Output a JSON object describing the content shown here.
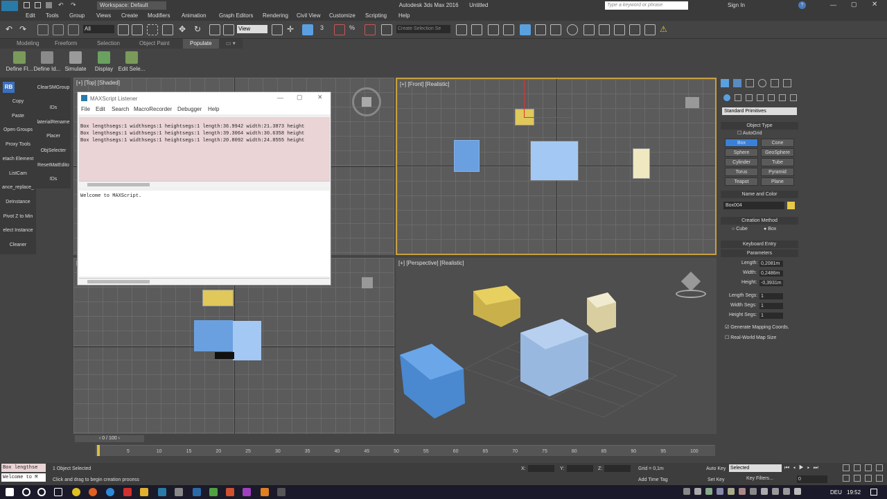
{
  "app": {
    "title": "Autodesk 3ds Max 2016",
    "document": "Untitled",
    "workspace": "Workspace: Default",
    "search_placeholder": "Type a keyword or phrase",
    "signin": "Sign In"
  },
  "menu": [
    "Edit",
    "Tools",
    "Group",
    "Views",
    "Create",
    "Modifiers",
    "Animation",
    "Graph Editors",
    "Rendering",
    "Civil View",
    "Customize",
    "Scripting",
    "Help"
  ],
  "toolbar": {
    "filter": "All",
    "view": "View",
    "selection_set": "Create Selection Se"
  },
  "ribbon_tabs": [
    "Modeling",
    "Freeform",
    "Selection",
    "Object Paint",
    "Populate"
  ],
  "ribbon_buttons": [
    "Define Fl...",
    "Define Id...",
    "Simulate",
    "Display",
    "Edit Sele..."
  ],
  "left_col1": [
    "Copy",
    "Paste",
    "Open Groups",
    "Proxy Tools",
    "etach Element",
    "ListCam",
    "ance_replace_",
    "DeInstance",
    "Pivot Z to Min",
    "elect Instance",
    "Cleaner"
  ],
  "left_col2": [
    "ClearSMGroup",
    "IDs",
    "laterialRename",
    "Placer",
    "ObjSelecter",
    "ResetMatEdito",
    "IDs"
  ],
  "viewports": {
    "top": "[+] [Top] [Shaded]",
    "front": "[+] [Front] [Realistic]",
    "left_partial": "[",
    "perspective": "[+] [Perspective] [Realistic]"
  },
  "listener": {
    "title": "MAXScript Listener",
    "menu": [
      "File",
      "Edit",
      "Search",
      "MacroRecorder",
      "Debugger",
      "Help"
    ],
    "output": [
      "Box lengthsegs:1 widthsegs:1 heightsegs:1 length:36.9942 width:21.3873 height",
      "Box lengthsegs:1 widthsegs:1 heightsegs:1 length:39.3064 width:30.6358 height",
      "Box lengthsegs:1 widthsegs:1 heightsegs:1 length:20.8092 width:24.8555 height"
    ],
    "input": "Welcome to MAXScript."
  },
  "command_panel": {
    "category": "Standard Primitives",
    "object_type": "Object Type",
    "autogrid": "AutoGrid",
    "primitives": [
      "Box",
      "Cone",
      "Sphere",
      "GeoSphere",
      "Cylinder",
      "Tube",
      "Torus",
      "Pyramid",
      "Teapot",
      "Plane"
    ],
    "name_color": "Name and Color",
    "object_name": "Box004",
    "object_color": "#e8c84a",
    "creation_method": "Creation Method",
    "cube": "Cube",
    "box": "Box",
    "keyboard_entry": "Keyboard Entry",
    "parameters": "Parameters",
    "length_label": "Length:",
    "length": "0,2081m",
    "width_label": "Width:",
    "width": "0,2486m",
    "height_label": "Height:",
    "height": "-0,3931m",
    "lsegs_label": "Length Segs:",
    "lsegs": "1",
    "wsegs_label": "Width Segs:",
    "wsegs": "1",
    "hsegs_label": "Height Segs:",
    "hsegs": "1",
    "gen_mapping": "Generate Mapping Coords.",
    "real_world": "Real-World Map Size"
  },
  "timeline": {
    "frame": "0 / 100",
    "ticks": [
      "5",
      "10",
      "15",
      "20",
      "25",
      "30",
      "35",
      "40",
      "45",
      "50",
      "55",
      "60",
      "65",
      "70",
      "75",
      "80",
      "85",
      "90",
      "95",
      "100"
    ]
  },
  "status": {
    "mini_out": "Box lengthse",
    "mini_in": "Welcome to M",
    "selected": "1 Object Selected",
    "prompt": "Click and drag to begin creation process",
    "x": "X:",
    "y": "Y:",
    "z": "Z:",
    "grid": "Grid = 0,1m",
    "add_time_tag": "Add Time Tag",
    "auto_key": "Auto Key",
    "set_key": "Set Key",
    "key_mode": "Selected",
    "key_filters": "Key Filters...",
    "frame_field": "0"
  },
  "taskbar": {
    "lang": "DEU",
    "time": "19:52"
  }
}
